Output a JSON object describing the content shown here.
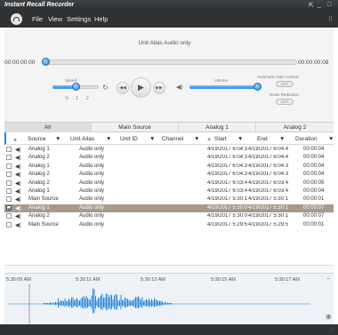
{
  "app": {
    "title": "Instant Recall Recorder"
  },
  "menu": [
    "File",
    "View",
    "Settings",
    "Help"
  ],
  "player": {
    "caption": "Unit Alias Audio only",
    "time_start": "00:00:00:00",
    "time_end": "00:00:00:08",
    "position_fraction": 0.0,
    "speed_label": "Speed",
    "speed_ticks": [
      "½",
      "1",
      "2"
    ],
    "speed_fraction": 0.5,
    "volume_label": "Volume",
    "volume_fraction": 0.96,
    "agc_label": "Automatic Gain Control",
    "agc_state": "OFF",
    "noise_label": "Noise Reduction",
    "noise_state": "OFF"
  },
  "tabs": [
    "All",
    "Main Source",
    "Analog 1",
    "Analog 2"
  ],
  "columns": [
    "Source",
    "Unit Alias",
    "Unit ID",
    "Channel",
    "Start",
    "End",
    "Duration"
  ],
  "rows": [
    {
      "source": "Analog 1",
      "alias": "Audio only",
      "start": "4/19/2017 6:04:3",
      "end": "4/19/2017 6:04:4",
      "dur": "00:00:04",
      "checked": false,
      "selected": false
    },
    {
      "source": "Analog 2",
      "alias": "Audio only",
      "start": "4/19/2017 6:04:3",
      "end": "4/19/2017 6:04:4",
      "dur": "00:00:04",
      "checked": false,
      "selected": false
    },
    {
      "source": "Analog 1",
      "alias": "Audio only",
      "start": "4/19/2017 6:04:3",
      "end": "4/19/2017 6:04:3",
      "dur": "00:00:04",
      "checked": false,
      "selected": false
    },
    {
      "source": "Analog 2",
      "alias": "Audio only",
      "start": "4/19/2017 6:04:3",
      "end": "4/19/2017 6:04:3",
      "dur": "00:00:04",
      "checked": false,
      "selected": false
    },
    {
      "source": "Analog 2",
      "alias": "Audio only",
      "start": "4/19/2017 6:03:4",
      "end": "4/19/2017 6:03:4",
      "dur": "00:00:05",
      "checked": false,
      "selected": false
    },
    {
      "source": "Analog 1",
      "alias": "Audio only",
      "start": "4/19/2017 6:03:4",
      "end": "4/19/2017 6:03:4",
      "dur": "00:00:04",
      "checked": false,
      "selected": false
    },
    {
      "source": "Main Source",
      "alias": "Audio only",
      "start": "4/19/2017 5:30:1",
      "end": "4/19/2017 5:30:1",
      "dur": "00:00:01",
      "checked": false,
      "selected": false
    },
    {
      "source": "Analog 1",
      "alias": "Audio only",
      "start": "4/19/2017 5:30:0",
      "end": "4/19/2017 5:30:1",
      "dur": "00:00:07",
      "checked": true,
      "selected": true
    },
    {
      "source": "Analog 2",
      "alias": "Audio only",
      "start": "4/19/2017 5:30:0",
      "end": "4/19/2017 5:30:1",
      "dur": "00:00:07",
      "checked": false,
      "selected": false
    },
    {
      "source": "Main Source",
      "alias": "Audio only",
      "start": "4/19/2017 5:29:5",
      "end": "4/19/2017 5:29:5",
      "dur": "00:00:01",
      "checked": false,
      "selected": false
    }
  ],
  "waveform": {
    "time_labels": [
      "5:30:09 AM",
      "5:30:11 AM",
      "5:30:13 AM",
      "5:30:15 AM",
      "5:30:17 AM"
    ],
    "color": "#2b86d8"
  }
}
